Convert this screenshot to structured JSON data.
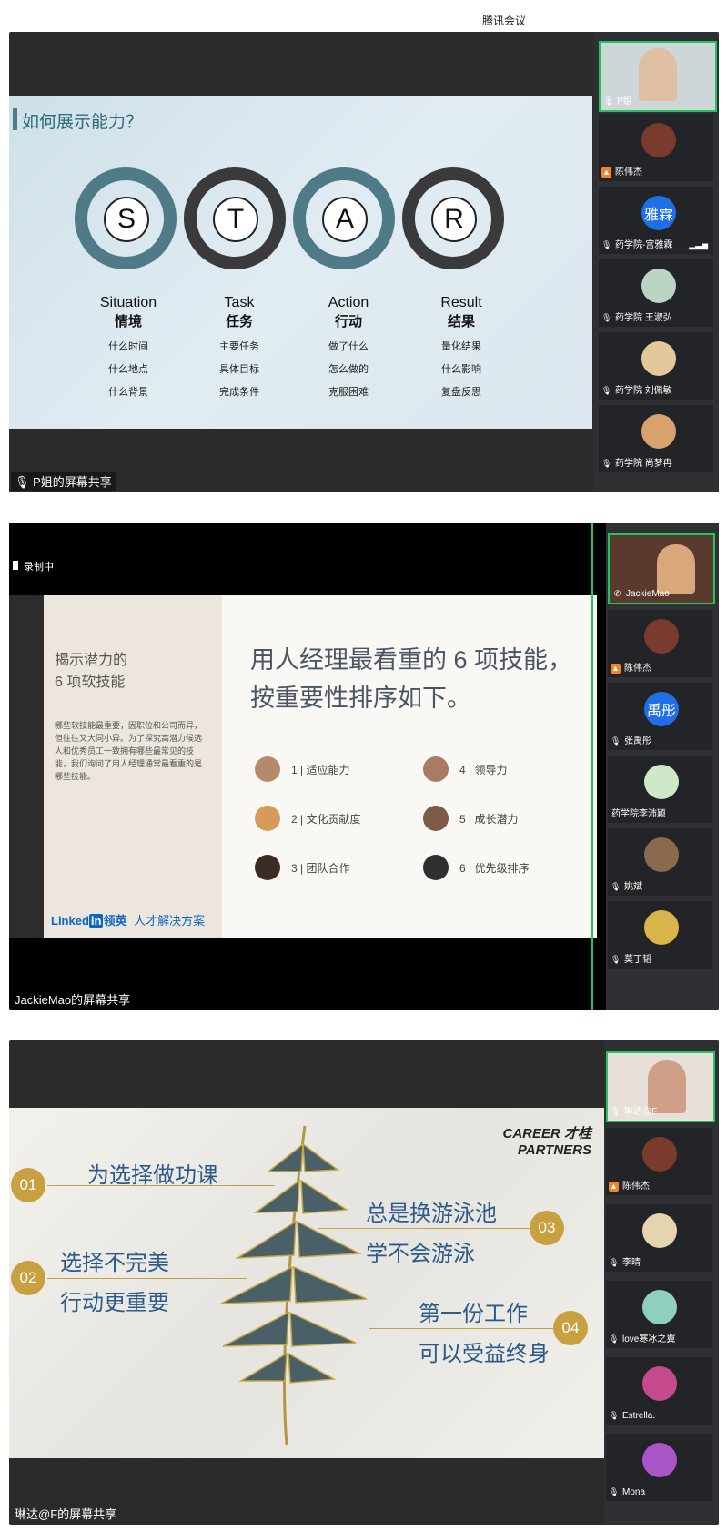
{
  "app_title": "腾讯会议",
  "panel1": {
    "share_label": "P姐的屏幕共享",
    "slide_title": "如何展示能力？",
    "letters": [
      "S",
      "T",
      "A",
      "R"
    ],
    "columns": [
      {
        "en": "Situation",
        "cn": "情境",
        "items": [
          "什么时间",
          "什么地点",
          "什么背景"
        ]
      },
      {
        "en": "Task",
        "cn": "任务",
        "items": [
          "主要任务",
          "具体目标",
          "完成条件"
        ]
      },
      {
        "en": "Action",
        "cn": "行动",
        "items": [
          "做了什么",
          "怎么做的",
          "克服困难"
        ]
      },
      {
        "en": "Result",
        "cn": "结果",
        "items": [
          "量化结果",
          "什么影响",
          "复盘反思"
        ]
      }
    ],
    "participants": [
      {
        "name": "P姐",
        "avatar": "",
        "video": true
      },
      {
        "name": "陈伟杰",
        "avatar": "",
        "video": false
      },
      {
        "name": "药学院-宫雅霖",
        "avatar": "雅霖",
        "video": false
      },
      {
        "name": "药学院 王淑弘",
        "avatar": "",
        "video": false
      },
      {
        "name": "药学院 刘佩敏",
        "avatar": "",
        "video": false
      },
      {
        "name": "药学院 尚梦冉",
        "avatar": "",
        "video": false
      }
    ]
  },
  "panel2": {
    "recording_label": "录制中",
    "share_label": "JackieMao的屏幕共享",
    "left_title_line1": "揭示潜力的",
    "left_title_line2": "6 项软技能",
    "left_body": "哪些软技能最重要，因职位和公司而异，但往往又大同小异。为了探究高潜力候选人和优秀员工一致拥有哪些最常见的技能，我们询问了用人经理通常最看重的是哪些技能。",
    "brand_linked": "Linked",
    "brand_in": "in",
    "brand_cn": "领英",
    "brand_tagline": "人才解决方案",
    "headline_line1": "用人经理最看重的 6 项技能，",
    "headline_line2": "按重要性排序如下。",
    "skills": [
      "1 | 适应能力",
      "2 | 文化贡献度",
      "3 | 团队合作",
      "4 | 领导力",
      "5 | 成长潜力",
      "6 | 优先级排序"
    ],
    "participants": [
      {
        "name": "JackieMao",
        "avatar": "",
        "video": true
      },
      {
        "name": "陈伟杰",
        "avatar": "",
        "video": false
      },
      {
        "name": "张禹彤",
        "avatar": "禹彤",
        "video": false
      },
      {
        "name": "药学院李沛颖",
        "avatar": "",
        "video": false
      },
      {
        "name": "姚斌",
        "avatar": "",
        "video": false
      },
      {
        "name": "莫丁韬",
        "avatar": "",
        "video": false
      }
    ]
  },
  "panel3": {
    "share_label": "琳达@F的屏幕共享",
    "logo_line1": "CAREER 才桂",
    "logo_line2": "PARTNERS",
    "points": [
      {
        "num": "01",
        "lines": [
          "为选择做功课"
        ]
      },
      {
        "num": "02",
        "lines": [
          "选择不完美",
          "行动更重要"
        ]
      },
      {
        "num": "03",
        "lines": [
          "总是换游泳池",
          "学不会游泳"
        ]
      },
      {
        "num": "04",
        "lines": [
          "第一份工作",
          "可以受益终身"
        ]
      }
    ],
    "participants": [
      {
        "name": "琳达@F",
        "avatar": "",
        "video": true
      },
      {
        "name": "陈伟杰",
        "avatar": "",
        "video": false
      },
      {
        "name": "李晴",
        "avatar": "",
        "video": false
      },
      {
        "name": "love寒冰之翼",
        "avatar": "",
        "video": false
      },
      {
        "name": "Estrella.",
        "avatar": "",
        "video": false
      },
      {
        "name": "Mona",
        "avatar": "",
        "video": false
      }
    ]
  }
}
